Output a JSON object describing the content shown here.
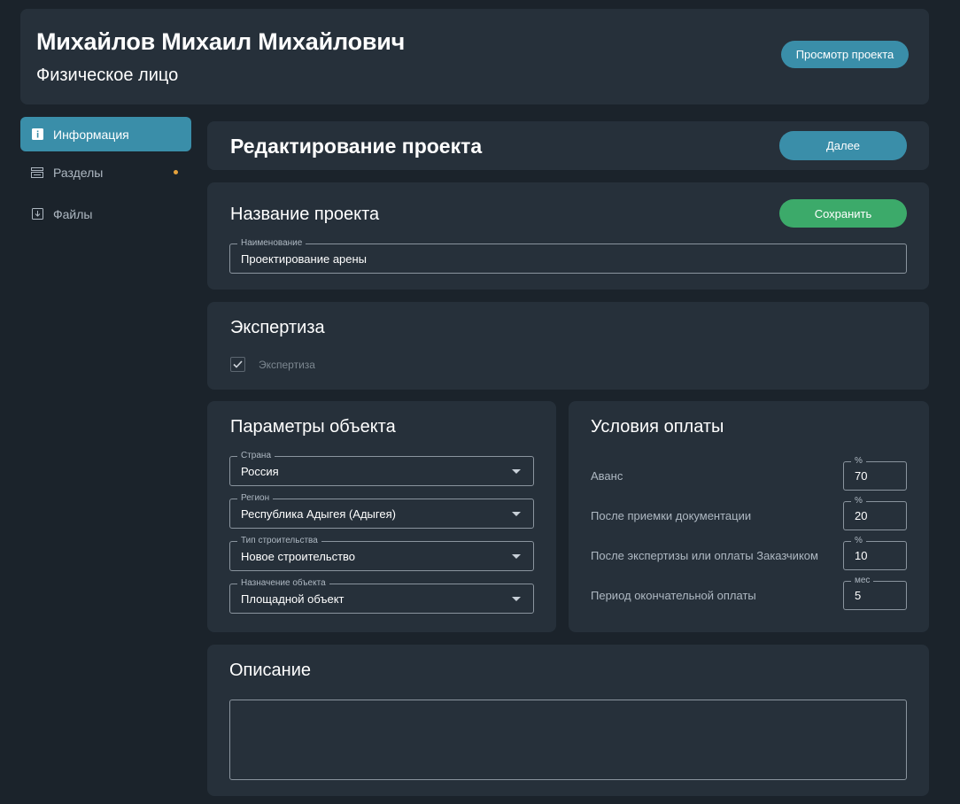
{
  "header": {
    "user_name": "Михайлов Михаил Михайлович",
    "user_type": "Физическое лицо",
    "view_button": "Просмотр проекта"
  },
  "sidebar": {
    "items": [
      {
        "label": "Информация",
        "icon": "info-icon",
        "active": true
      },
      {
        "label": "Разделы",
        "icon": "sections-icon",
        "active": false,
        "has_dot": true
      },
      {
        "label": "Файлы",
        "icon": "download-icon",
        "active": false
      }
    ]
  },
  "edit": {
    "title": "Редактирование проекта",
    "next_button": "Далее"
  },
  "project_name": {
    "title": "Название проекта",
    "save_button": "Сохранить",
    "field_label": "Наименование",
    "field_value": "Проектирование арены"
  },
  "expertise": {
    "title": "Экспертиза",
    "checkbox_label": "Экспертиза",
    "checked": true
  },
  "params": {
    "title": "Параметры объекта",
    "fields": [
      {
        "label": "Страна",
        "value": "Россия"
      },
      {
        "label": "Регион",
        "value": "Республика Адыгея (Адыгея)"
      },
      {
        "label": "Тип строительства",
        "value": "Новое строительство"
      },
      {
        "label": "Назначение объекта",
        "value": "Площадной объект"
      }
    ]
  },
  "payment": {
    "title": "Условия оплаты",
    "rows": [
      {
        "label": "Аванс",
        "unit": "%",
        "value": "70"
      },
      {
        "label": "После приемки документации",
        "unit": "%",
        "value": "20"
      },
      {
        "label": "После экспертизы или оплаты Заказчиком",
        "unit": "%",
        "value": "10"
      },
      {
        "label": "Период окончательной оплаты",
        "unit": "мес",
        "value": "5"
      }
    ]
  },
  "description": {
    "title": "Описание",
    "value": ""
  },
  "colors": {
    "background": "#1b232b",
    "card": "#26303a",
    "accent": "#3a8ea9",
    "save": "#3caa6a",
    "dot": "#e6a23c"
  }
}
